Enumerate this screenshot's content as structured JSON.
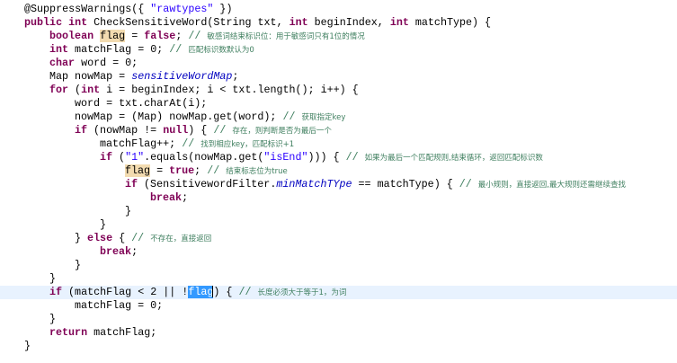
{
  "editor": {
    "current_line": 20,
    "lines": [
      {
        "indent": 0,
        "tokens": [
          [
            "txt",
            "@SuppressWarnings({ "
          ],
          [
            "str",
            "\"rawtypes\""
          ],
          [
            "txt",
            " })"
          ]
        ]
      },
      {
        "indent": 0,
        "tokens": [
          [
            "kw",
            "public"
          ],
          [
            "txt",
            " "
          ],
          [
            "kw",
            "int"
          ],
          [
            "txt",
            " CheckSensitiveWord(String txt, "
          ],
          [
            "kw",
            "int"
          ],
          [
            "txt",
            " beginIndex, "
          ],
          [
            "kw",
            "int"
          ],
          [
            "txt",
            " matchType) {"
          ]
        ]
      },
      {
        "indent": 1,
        "tokens": [
          [
            "kw",
            "boolean"
          ],
          [
            "txt",
            " "
          ],
          [
            "hl",
            "flag"
          ],
          [
            "txt",
            " = "
          ],
          [
            "kw",
            "false"
          ],
          [
            "txt",
            "; "
          ],
          [
            "cm",
            "// "
          ],
          [
            "cmz",
            "敏感词结束标识位：用于敏感词只有1位的情况"
          ]
        ]
      },
      {
        "indent": 1,
        "tokens": [
          [
            "kw",
            "int"
          ],
          [
            "txt",
            " matchFlag = 0; "
          ],
          [
            "cm",
            "// "
          ],
          [
            "cmz",
            "匹配标识数默认为0"
          ]
        ]
      },
      {
        "indent": 1,
        "tokens": [
          [
            "kw",
            "char"
          ],
          [
            "txt",
            " word = 0;"
          ]
        ]
      },
      {
        "indent": 1,
        "tokens": [
          [
            "txt",
            "Map nowMap = "
          ],
          [
            "fld",
            "sensitiveWordMap"
          ],
          [
            "txt",
            ";"
          ]
        ]
      },
      {
        "indent": 1,
        "tokens": [
          [
            "kw",
            "for"
          ],
          [
            "txt",
            " ("
          ],
          [
            "kw",
            "int"
          ],
          [
            "txt",
            " i = beginIndex; i < txt.length(); i++) {"
          ]
        ]
      },
      {
        "indent": 2,
        "tokens": [
          [
            "txt",
            "word = txt.charAt(i);"
          ]
        ]
      },
      {
        "indent": 2,
        "tokens": [
          [
            "txt",
            "nowMap = (Map) nowMap.get(word); "
          ],
          [
            "cm",
            "// "
          ],
          [
            "cmz",
            "获取指定key"
          ]
        ]
      },
      {
        "indent": 2,
        "tokens": [
          [
            "kw",
            "if"
          ],
          [
            "txt",
            " (nowMap != "
          ],
          [
            "kw",
            "null"
          ],
          [
            "txt",
            ") { "
          ],
          [
            "cm",
            "// "
          ],
          [
            "cmz",
            "存在，则判断是否为最后一个"
          ]
        ]
      },
      {
        "indent": 3,
        "tokens": [
          [
            "txt",
            "matchFlag++; "
          ],
          [
            "cm",
            "// "
          ],
          [
            "cmz",
            "找到相应key，匹配标识+1"
          ]
        ]
      },
      {
        "indent": 3,
        "tokens": [
          [
            "kw",
            "if"
          ],
          [
            "txt",
            " ("
          ],
          [
            "str",
            "\"1\""
          ],
          [
            "txt",
            ".equals(nowMap.get("
          ],
          [
            "str",
            "\"isEnd\""
          ],
          [
            "txt",
            "))) { "
          ],
          [
            "cm",
            "// "
          ],
          [
            "cmz",
            "如果为最后一个匹配规则,结束循环，返回匹配标识数"
          ]
        ]
      },
      {
        "indent": 4,
        "tokens": [
          [
            "hl",
            "flag"
          ],
          [
            "txt",
            " = "
          ],
          [
            "kw",
            "true"
          ],
          [
            "txt",
            "; "
          ],
          [
            "cm",
            "// "
          ],
          [
            "cmz",
            "结束标志位为true"
          ]
        ]
      },
      {
        "indent": 4,
        "tokens": [
          [
            "kw",
            "if"
          ],
          [
            "txt",
            " (SensitivewordFilter."
          ],
          [
            "fld",
            "minMatchTYpe"
          ],
          [
            "txt",
            " == matchType) { "
          ],
          [
            "cm",
            "// "
          ],
          [
            "cmz",
            "最小规则，直接返回,最大规则还需继续查找"
          ]
        ]
      },
      {
        "indent": 5,
        "tokens": [
          [
            "kw",
            "break"
          ],
          [
            "txt",
            ";"
          ]
        ]
      },
      {
        "indent": 4,
        "tokens": [
          [
            "txt",
            "}"
          ]
        ]
      },
      {
        "indent": 3,
        "tokens": [
          [
            "txt",
            "}"
          ]
        ]
      },
      {
        "indent": 2,
        "tokens": [
          [
            "txt",
            "} "
          ],
          [
            "kw",
            "else"
          ],
          [
            "txt",
            " { "
          ],
          [
            "cm",
            "// "
          ],
          [
            "cmz",
            "不存在，直接返回"
          ]
        ]
      },
      {
        "indent": 3,
        "tokens": [
          [
            "kw",
            "break"
          ],
          [
            "txt",
            ";"
          ]
        ]
      },
      {
        "indent": 2,
        "tokens": [
          [
            "txt",
            "}"
          ]
        ]
      },
      {
        "indent": 1,
        "tokens": [
          [
            "txt",
            "}"
          ]
        ]
      },
      {
        "indent": 1,
        "tokens": [
          [
            "kw",
            "if"
          ],
          [
            "txt",
            " (matchFlag < 2 || !"
          ],
          [
            "sel",
            "flag"
          ],
          [
            "caret",
            ""
          ],
          [
            "txt",
            ") { "
          ],
          [
            "cm",
            "// "
          ],
          [
            "cmz",
            "长度必须大于等于1，为词"
          ]
        ]
      },
      {
        "indent": 2,
        "tokens": [
          [
            "txt",
            "matchFlag = 0;"
          ]
        ]
      },
      {
        "indent": 1,
        "tokens": [
          [
            "txt",
            "}"
          ]
        ]
      },
      {
        "indent": 1,
        "tokens": [
          [
            "kw",
            "return"
          ],
          [
            "txt",
            " matchFlag;"
          ]
        ]
      },
      {
        "indent": 0,
        "tokens": [
          [
            "txt",
            "}"
          ]
        ]
      }
    ]
  }
}
